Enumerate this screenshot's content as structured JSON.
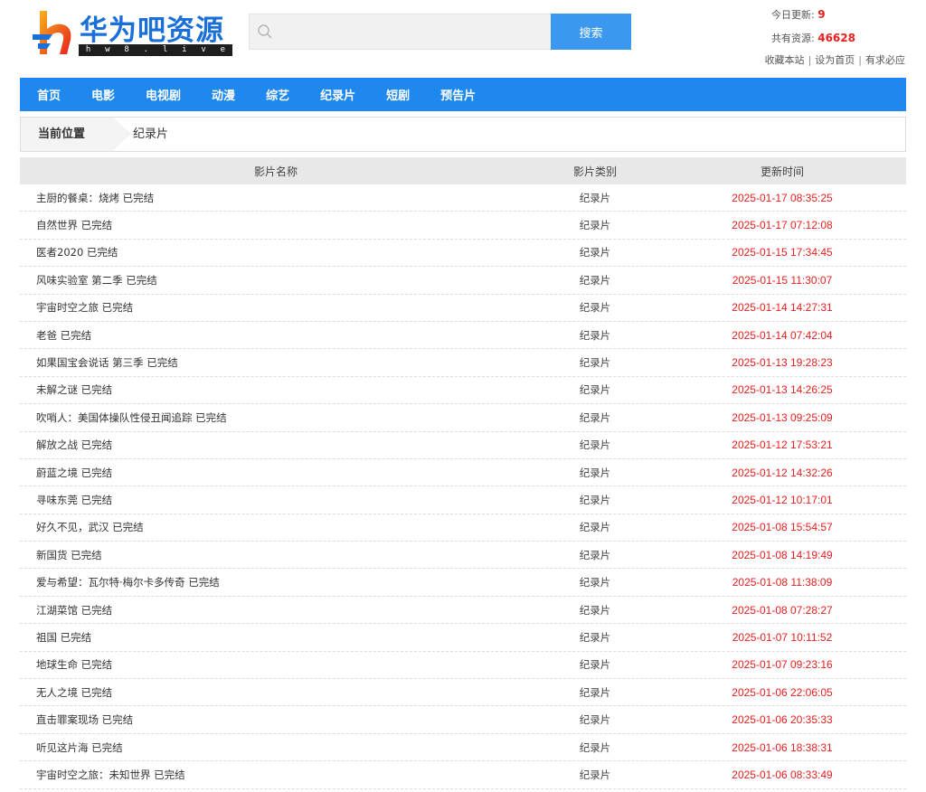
{
  "brand": {
    "title": "华为吧资源",
    "domain_letters": [
      "h",
      "w",
      "8",
      ".",
      "l",
      "i",
      "v",
      "e"
    ],
    "accent": "#1e88ef",
    "highlight": "#e8201e"
  },
  "search": {
    "placeholder": "",
    "value": "",
    "button_label": "搜索",
    "icon": "search-icon"
  },
  "stats": {
    "today_label": "今日更新:",
    "today_value": "9",
    "total_label": "共有资源:",
    "total_value": "46628",
    "links": [
      "收藏本站",
      "设为首页",
      "有求必应"
    ]
  },
  "nav": {
    "items": [
      "首页",
      "电影",
      "电视剧",
      "动漫",
      "综艺",
      "纪录片",
      "短剧",
      "预告片"
    ]
  },
  "breadcrumb": {
    "label": "当前位置",
    "current": "纪录片"
  },
  "table": {
    "headers": [
      "影片名称",
      "影片类别",
      "更新时间"
    ],
    "rows": [
      {
        "name": "主厨的餐桌：烧烤 已完结",
        "category": "纪录片",
        "time": "2025-01-17 08:35:25"
      },
      {
        "name": "自然世界 已完结",
        "category": "纪录片",
        "time": "2025-01-17 07:12:08"
      },
      {
        "name": "医者2020 已完结",
        "category": "纪录片",
        "time": "2025-01-15 17:34:45"
      },
      {
        "name": "风味实验室 第二季 已完结",
        "category": "纪录片",
        "time": "2025-01-15 11:30:07"
      },
      {
        "name": "宇宙时空之旅 已完结",
        "category": "纪录片",
        "time": "2025-01-14 14:27:31"
      },
      {
        "name": "老爸 已完结",
        "category": "纪录片",
        "time": "2025-01-14 07:42:04"
      },
      {
        "name": "如果国宝会说话 第三季 已完结",
        "category": "纪录片",
        "time": "2025-01-13 19:28:23"
      },
      {
        "name": "未解之谜 已完结",
        "category": "纪录片",
        "time": "2025-01-13 14:26:25"
      },
      {
        "name": "吹哨人：美国体操队性侵丑闻追踪 已完结",
        "category": "纪录片",
        "time": "2025-01-13 09:25:09"
      },
      {
        "name": "解放之战 已完结",
        "category": "纪录片",
        "time": "2025-01-12 17:53:21"
      },
      {
        "name": "蔚蓝之境 已完结",
        "category": "纪录片",
        "time": "2025-01-12 14:32:26"
      },
      {
        "name": "寻味东莞 已完结",
        "category": "纪录片",
        "time": "2025-01-12 10:17:01"
      },
      {
        "name": "好久不见，武汉 已完结",
        "category": "纪录片",
        "time": "2025-01-08 15:54:57"
      },
      {
        "name": "新国货 已完结",
        "category": "纪录片",
        "time": "2025-01-08 14:19:49"
      },
      {
        "name": "爱与希望：瓦尔特·梅尔卡多传奇 已完结",
        "category": "纪录片",
        "time": "2025-01-08 11:38:09"
      },
      {
        "name": "江湖菜馆 已完结",
        "category": "纪录片",
        "time": "2025-01-08 07:28:27"
      },
      {
        "name": "祖国 已完结",
        "category": "纪录片",
        "time": "2025-01-07 10:11:52"
      },
      {
        "name": "地球生命 已完结",
        "category": "纪录片",
        "time": "2025-01-07 09:23:16"
      },
      {
        "name": "无人之境 已完结",
        "category": "纪录片",
        "time": "2025-01-06 22:06:05"
      },
      {
        "name": "直击罪案现场 已完结",
        "category": "纪录片",
        "time": "2025-01-06 20:35:33"
      },
      {
        "name": "听见这片海 已完结",
        "category": "纪录片",
        "time": "2025-01-06 18:38:31"
      },
      {
        "name": "宇宙时空之旅：未知世界 已完结",
        "category": "纪录片",
        "time": "2025-01-06 08:33:49"
      }
    ]
  }
}
